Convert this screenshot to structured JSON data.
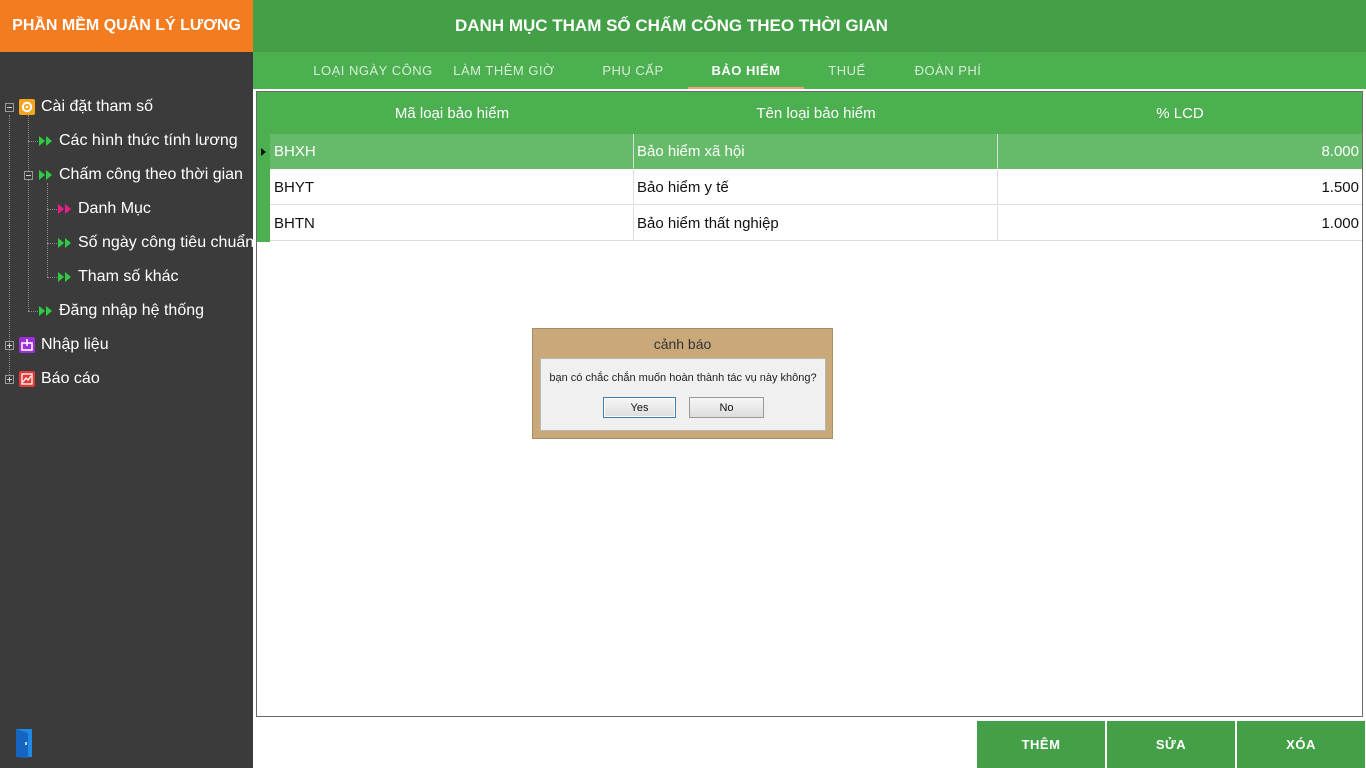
{
  "app": {
    "brand": "PHẦN MỀM QUẢN LÝ LƯƠNG"
  },
  "header": {
    "title": "DANH MỤC THAM SỐ CHẤM CÔNG THEO THỜI GIAN"
  },
  "tabs": [
    {
      "label": "LOẠI NGÀY CÔNG"
    },
    {
      "label": "LÀM THÊM GIỜ"
    },
    {
      "label": "PHỤ CẤP"
    },
    {
      "label": "BẢO HIỂM",
      "active": true
    },
    {
      "label": "THUẾ"
    },
    {
      "label": "ĐOÀN PHÍ"
    }
  ],
  "sidebar": {
    "items": [
      {
        "label": "Cài đặt tham số",
        "icon": "gear-icon"
      },
      {
        "label": "Các hình thức tính lương",
        "icon": "double-arrow-icon"
      },
      {
        "label": "Chấm công theo thời gian",
        "icon": "double-arrow-icon"
      },
      {
        "label": "Danh Mục",
        "icon": "double-arrow-icon",
        "selected": true
      },
      {
        "label": "Số ngày công tiêu chuẩn",
        "icon": "double-arrow-icon"
      },
      {
        "label": "Tham số khác",
        "icon": "double-arrow-icon"
      },
      {
        "label": "Đăng nhập hệ thống",
        "icon": "double-arrow-icon"
      },
      {
        "label": "Nhập liệu",
        "icon": "import-icon"
      },
      {
        "label": "Báo cáo",
        "icon": "report-icon"
      }
    ]
  },
  "grid": {
    "columns": [
      "Mã loại bảo hiểm",
      "Tên loại bảo hiểm",
      "% LCD"
    ],
    "rows": [
      {
        "code": "BHXH",
        "name": "Bảo hiểm xã hội",
        "percent": "8.000",
        "selected": true
      },
      {
        "code": "BHYT",
        "name": "Bảo hiểm y tế",
        "percent": "1.500"
      },
      {
        "code": "BHTN",
        "name": "Bảo hiểm thất nghiệp",
        "percent": "1.000"
      }
    ]
  },
  "dialog": {
    "title": "cảnh báo",
    "message": "bạn có chắc chắn muốn hoàn thành tác vụ này không?",
    "yes_label": "Yes",
    "no_label": "No"
  },
  "actions": {
    "add": "THÊM",
    "edit": "SỬA",
    "delete": "XÓA"
  },
  "colors": {
    "brand": "#f47c20",
    "header_green": "#43a047",
    "grid_green": "#4caf50",
    "selected_row": "#66bb6a",
    "sidebar_bg": "#3b3b3b",
    "dialog_bg": "#c9a97a"
  }
}
